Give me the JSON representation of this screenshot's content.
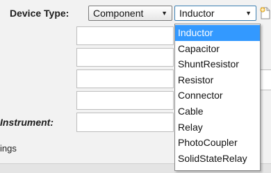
{
  "device_type": {
    "label": "Device Type:",
    "category_select": "Component",
    "type_select": "Inductor"
  },
  "instrument_label": "Instrument:",
  "settings_label": "ings",
  "dropdown": {
    "options": [
      "Inductor",
      "Capacitor",
      "ShuntResistor",
      "Resistor",
      "Connector",
      "Cable",
      "Relay",
      "PhotoCoupler",
      "SolidStateRelay"
    ],
    "selected": "Inductor"
  },
  "icons": {
    "new_item": "new-document-icon",
    "dropdown_arrow": "chevron-down-icon"
  },
  "colors": {
    "highlight": "#3399ff",
    "background": "#f2f2f2"
  }
}
